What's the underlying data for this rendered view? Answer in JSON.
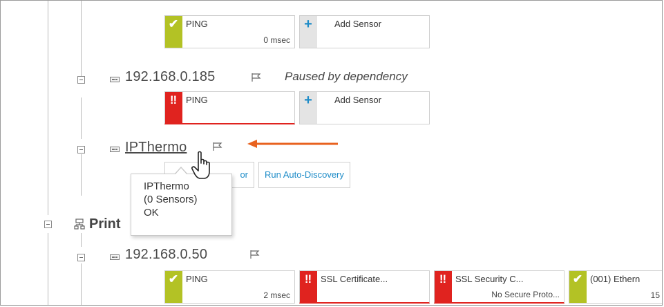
{
  "devices": [
    {
      "name": "192.168.0.185",
      "status": "Paused by dependency",
      "sensors": [
        {
          "name": "PING",
          "value": "",
          "state": "down"
        },
        {
          "name": "Add Sensor"
        }
      ]
    },
    {
      "name": "IPThermo",
      "actions": [
        "Add Sensor",
        "Run Auto-Discovery"
      ],
      "partial_action": "or"
    },
    {
      "name": "192.168.0.50",
      "sensors": [
        {
          "name": "PING",
          "value": "2 msec",
          "state": "up"
        },
        {
          "name": "SSL Certificate...",
          "value": "",
          "state": "down"
        },
        {
          "name": "SSL Security C...",
          "value": "No Secure Proto...",
          "state": "down"
        },
        {
          "name": "(001) Ethern",
          "value": "15",
          "state": "up"
        }
      ]
    }
  ],
  "top_row": {
    "sensors": [
      {
        "name": "PING",
        "value": "0 msec",
        "state": "up"
      },
      {
        "name": "Add Sensor"
      }
    ]
  },
  "group": {
    "name": "Print"
  },
  "tooltip": {
    "lines": [
      "IPThermo",
      "(0 Sensors)",
      "OK"
    ]
  },
  "colors": {
    "up": "#b3c225",
    "down": "#e0231f",
    "add": "#1e8cc8",
    "annotation_arrow": "#e8621f"
  },
  "icons": {
    "up": "check-icon",
    "down": "exclamation-icon",
    "add": "plus-icon",
    "flag": "flag-icon",
    "device": "device-icon",
    "group": "group-icon",
    "toggle": "collapse-icon",
    "pointer": "hand-pointer-icon"
  }
}
